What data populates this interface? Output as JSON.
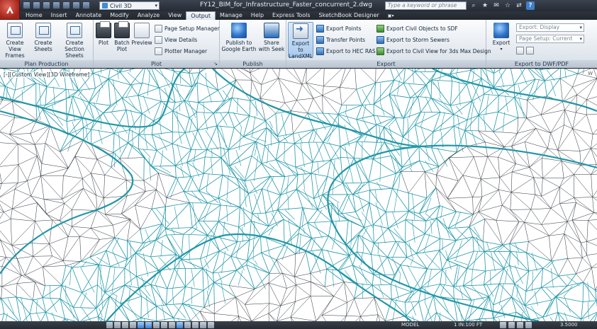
{
  "titlebar": {
    "workspace": "Civil 3D",
    "window_title": "FY12_BIM_for_Infrastructure_Faster_concurrent_2.dwg",
    "search_placeholder": "Type a keyword or phrase",
    "help_label": "?"
  },
  "tabs": [
    {
      "label": "Home"
    },
    {
      "label": "Insert"
    },
    {
      "label": "Annotate"
    },
    {
      "label": "Modify"
    },
    {
      "label": "Analyze"
    },
    {
      "label": "View"
    },
    {
      "label": "Output"
    },
    {
      "label": "Manage"
    },
    {
      "label": "Help"
    },
    {
      "label": "Express Tools"
    },
    {
      "label": "SketchBook Designer"
    }
  ],
  "ribbon": {
    "plan_production": {
      "title": "Plan Production",
      "buttons": [
        {
          "label": "Create View Frames"
        },
        {
          "label": "Create Sheets"
        },
        {
          "label": "Create Section Sheets"
        }
      ]
    },
    "plot": {
      "title": "Plot",
      "large": [
        {
          "label": "Plot"
        },
        {
          "label": "Batch Plot"
        },
        {
          "label": "Preview"
        }
      ],
      "small": [
        {
          "label": "Page Setup Manager"
        },
        {
          "label": "View Details"
        },
        {
          "label": "Plotter Manager"
        }
      ]
    },
    "publish": {
      "title": "Publish",
      "buttons": [
        {
          "label": "Publish to Google Earth"
        },
        {
          "label": "Share with Seek"
        }
      ]
    },
    "export": {
      "title": "Export",
      "large": {
        "label": "Export to LandXML"
      },
      "col1": [
        {
          "label": "Export Points"
        },
        {
          "label": "Transfer Points"
        },
        {
          "label": "Export to HEC RAS"
        }
      ],
      "col2": [
        {
          "label": "Export Civil Objects to SDF"
        },
        {
          "label": "Export to Storm Sewers"
        },
        {
          "label": "Export to Civil View for 3ds Max Design"
        }
      ]
    },
    "export_dwf": {
      "title": "Export to DWF/PDF",
      "button": {
        "label": "Export"
      },
      "export_combo": "Export: Display",
      "page_setup_combo": "Page Setup: Current"
    }
  },
  "viewport": {
    "view_label": "[-][Custom View][3D Wireframe]",
    "compass": "W"
  },
  "statusbar": {
    "model_label": "MODEL",
    "scale_label": "1 IN:100 FT",
    "scale_value": "3.5000"
  },
  "colors": {
    "road_mesh": "#1f97a8",
    "terrain_mesh": "#2a2f36",
    "ribbon_active_tab": "#dfe5ec",
    "app_button": "#b22a1e"
  }
}
